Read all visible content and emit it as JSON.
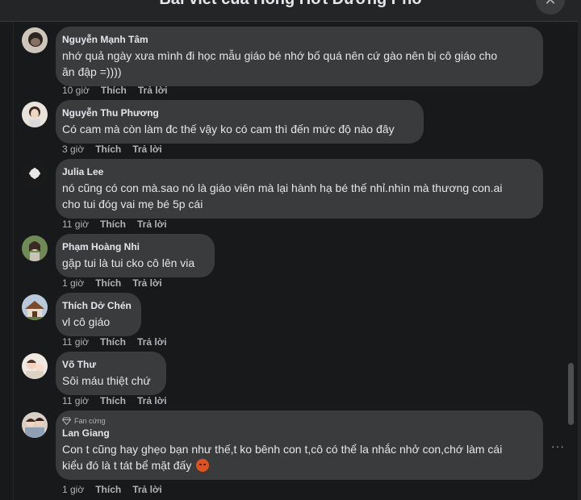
{
  "modal": {
    "title": "Bài viết của Hóng Hớt Đường Phố",
    "close_icon": "close-icon"
  },
  "comments": [
    {
      "author": "Nguyễn Mạnh Tâm",
      "text": "nhớ quả ngày xưa mình đi học mẫu giáo bé nhớ bố quá nên cứ gào nên bị cô giáo cho\năn đập =))))",
      "time": "10 giờ",
      "like": "Thích",
      "reply": "Trả lời"
    },
    {
      "author": "Nguyễn Thu Phương",
      "text": "Có cam mà còn làm đc thế vậy ko có cam thì đến mức độ nào đây",
      "time": "3 giờ",
      "like": "Thích",
      "reply": "Trả lời"
    },
    {
      "author": "Julia Lee",
      "text": "nó cũng có con mà.sao nó là giáo viên mà lại hành hạ bé thế nhỉ.nhìn mà thương con.ai\ncho tui đóg vai mẹ bé 5p cái",
      "time": "11 giờ",
      "like": "Thích",
      "reply": "Trả lời"
    },
    {
      "author": "Phạm Hoàng Nhi",
      "text": "gặp tui là tui cko cô lên via",
      "time": "1 giờ",
      "like": "Thích",
      "reply": "Trả lời"
    },
    {
      "author": "Thích Dở Chén",
      "text": "vl cô giáo",
      "time": "11 giờ",
      "like": "Thích",
      "reply": "Trả lời"
    },
    {
      "author": "Võ Thư",
      "text": "Sôi máu thiệt chứ",
      "time": "11 giờ",
      "like": "Thích",
      "reply": "Trả lời"
    },
    {
      "badge": "Fan cứng",
      "author": "Lan Giang",
      "text": "Con t cũng hay ghẹo bạn như thế,t ko bênh con t,cô có thể la nhắc nhở con,chớ làm cái\nkiểu đó là t tát bể mặt đấy",
      "emoji": "angry-face-emoji",
      "time": "1 giờ",
      "like": "Thích",
      "reply": "Trả lời",
      "more": "···"
    }
  ],
  "colors": {
    "background": "#18191a",
    "bubble": "#3a3b3c",
    "text": "#e4e6eb",
    "secondary_text": "#b0b3b8"
  }
}
